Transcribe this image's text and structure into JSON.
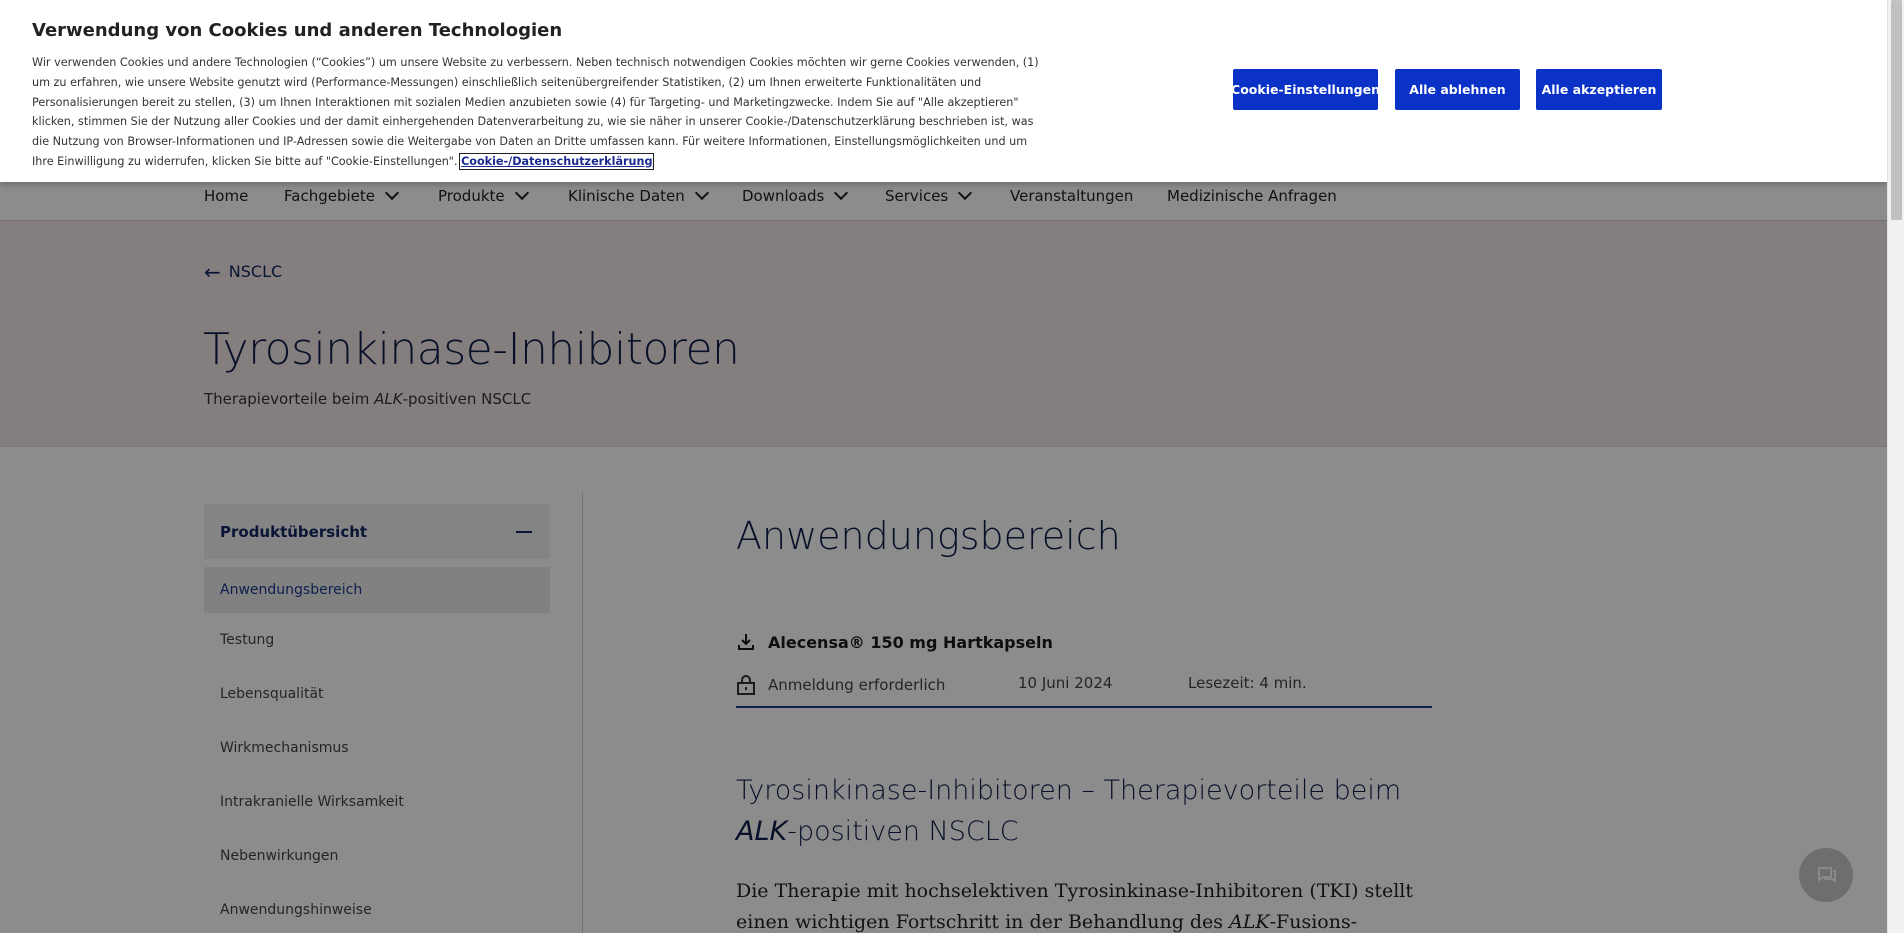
{
  "cookie_banner": {
    "title": "Verwendung von Cookies und anderen Technologien",
    "text": "Wir verwenden Cookies und andere Technologien (“Cookies”) um unsere Website zu verbessern. Neben technisch notwendigen Cookies möchten wir gerne Cookies verwenden, (1) um zu erfahren, wie unsere Website genutzt wird (Performance-Messungen) einschließlich seitenübergreifender Statistiken, (2) um Ihnen erweiterte Funktionalitäten und Personalisierungen bereit zu stellen, (3) um Ihnen Interaktionen mit sozialen Medien anzubieten sowie (4) für Targeting- und Marketingzwecke. Indem Sie auf \"Alle akzeptieren\" klicken, stimmen Sie der Nutzung aller Cookies und der damit einhergehenden Datenverarbeitung zu, wie sie näher in unserer Cookie-/Datenschutzerklärung beschrieben ist, was die Nutzung von Browser-Informationen und IP-Adressen sowie die Weitergabe von Daten an Dritte umfassen kann. Für weitere Informationen, Einstellungsmöglichkeiten und um Ihre Einwilligung zu widerrufen, klicken Sie bitte auf \"Cookie-Einstellungen\".",
    "link_label": "Cookie-/Datenschutzerklärung",
    "settings_label": "Cookie-Einstellungen",
    "reject_label": "Alle ablehnen",
    "accept_label": "Alle akzeptieren"
  },
  "nav": {
    "items": [
      {
        "label": "Home"
      },
      {
        "label": "Fachgebiete"
      },
      {
        "label": "Produkte"
      },
      {
        "label": "Klinische Daten"
      },
      {
        "label": "Downloads"
      },
      {
        "label": "Services"
      },
      {
        "label": "Veranstaltungen"
      },
      {
        "label": "Medizinische Anfragen"
      }
    ]
  },
  "hero": {
    "back_label": "NSCLC",
    "title": "Tyrosinkinase-Inhibitoren",
    "subtitle_pre": "Therapievorteile beim ",
    "subtitle_em": "ALK",
    "subtitle_post": "-positiven NSCLC"
  },
  "sidebar": {
    "header": "Produktübersicht",
    "items": [
      {
        "label": "Anwendungsbereich"
      },
      {
        "label": "Testung"
      },
      {
        "label": "Lebensqualität"
      },
      {
        "label": "Wirkmechanismus"
      },
      {
        "label": "Intrakranielle Wirksamkeit"
      },
      {
        "label": "Nebenwirkungen"
      },
      {
        "label": "Anwendungshinweise"
      }
    ]
  },
  "content": {
    "heading": "Anwendungsbereich",
    "document_label": "Alecensa® 150 mg Hartkapseln",
    "login_label": "Anmeldung erforderlich",
    "date": "10 Juni 2024",
    "reading_time": "Lesezeit: 4 min.",
    "subheading_pre": "Tyrosinkinase-Inhibitoren – Therapievorteile beim ",
    "subheading_em": "ALK",
    "subheading_post": "-positiven NSCLC",
    "body_pre": "Die Therapie mit hochselektiven Tyrosinkinase-Inhibitoren (TKI) stellt einen wichtigen Fortschritt in der Behandlung des ",
    "body_em": "ALK",
    "body_post": "-Fusions-positivem nicht-"
  },
  "colors": {
    "primary": "#0b32c6",
    "navy": "#0e1e4a",
    "hero_bg": "#f3e6e6"
  }
}
